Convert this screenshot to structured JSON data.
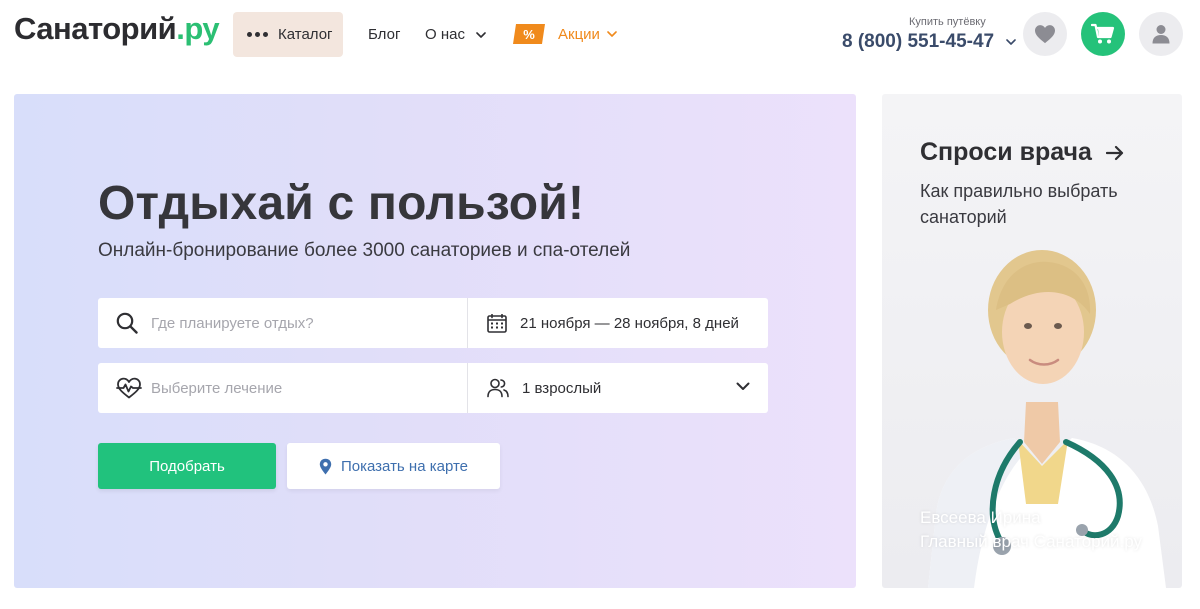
{
  "header": {
    "logo": {
      "text": "Санаторий",
      "suffix": ".ру"
    },
    "catalog_label": "Каталог",
    "nav": {
      "blog": "Блог",
      "about": "О нас"
    },
    "promo": {
      "badge": "%",
      "label": "Акции"
    },
    "phone_caption": "Купить путёвку",
    "phone": "8 (800) 551-45-47",
    "icons": {
      "favorites": "heart-icon",
      "cart": "cart-icon",
      "profile": "user-icon"
    }
  },
  "hero": {
    "title": "Отдыхай с пользой!",
    "subtitle": "Онлайн-бронирование более 3000 санаториев и спа-отелей",
    "search": {
      "destination_placeholder": "Где планируете отдых?",
      "dates_value": "21 ноября — 28 ноября, 8 дней",
      "treatment_placeholder": "Выберите лечение",
      "guests_value": "1 взрослый"
    },
    "buttons": {
      "pick": "Подобрать",
      "map": "Показать на карте"
    }
  },
  "doctor_card": {
    "heading": "Спроси врача",
    "topic": "Как правильно выбрать санаторий",
    "name": "Евсеева Ирина",
    "role": "Главный врач Санаторий.ру"
  },
  "colors": {
    "brand_green": "#25c27a",
    "promo_orange": "#f08a1c",
    "catalog_bg": "#f3e6de",
    "phone_text": "#3a4b6a",
    "map_link": "#3e6fae"
  }
}
